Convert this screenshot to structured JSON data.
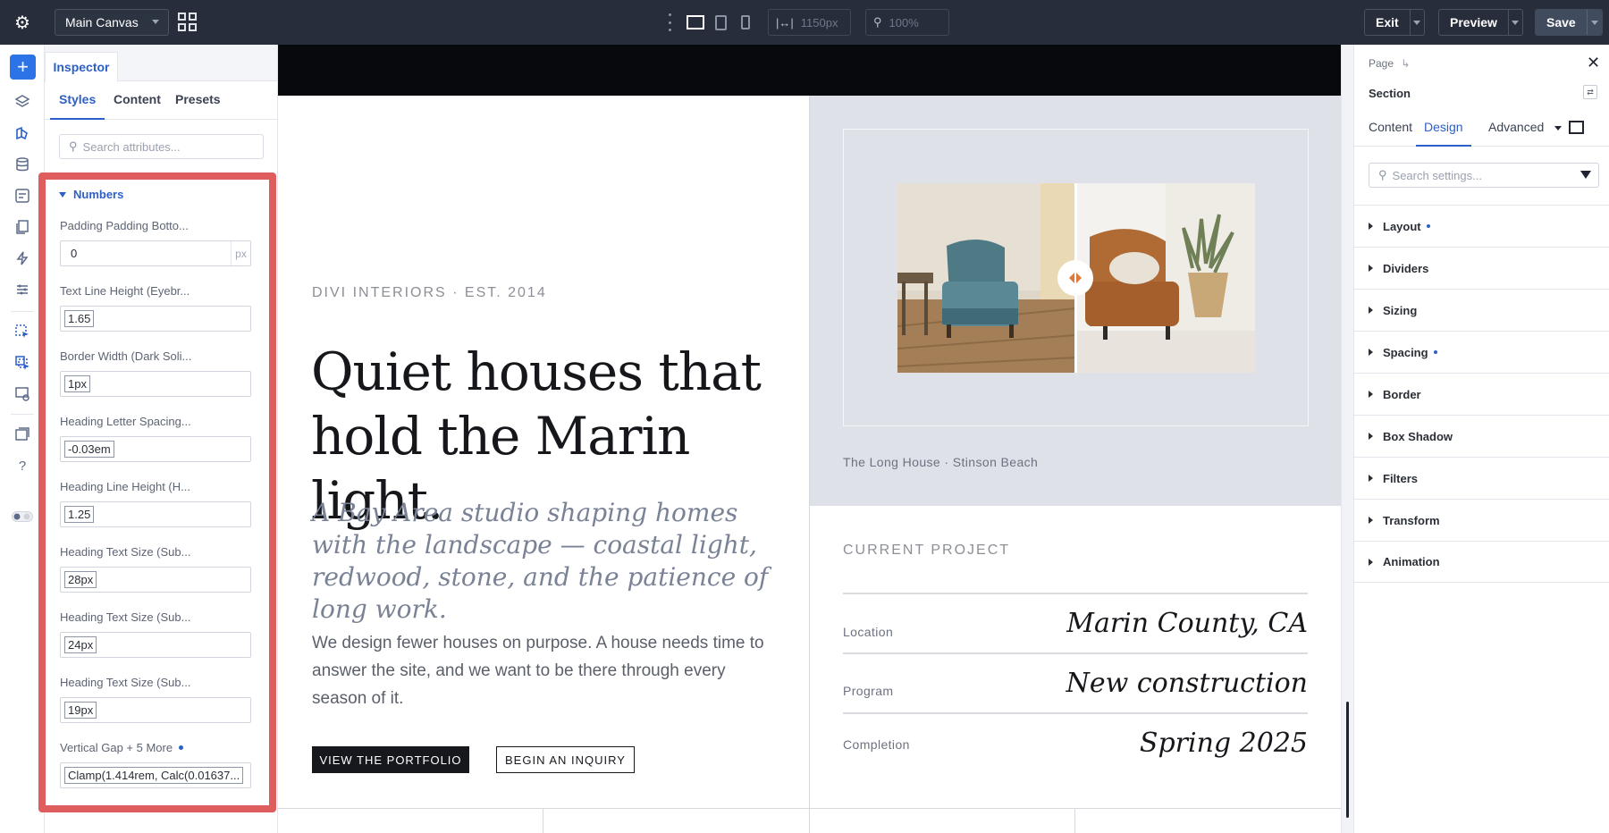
{
  "topbar": {
    "canvas_select": "Main Canvas",
    "width_value": "1150px",
    "zoom_value": "100%",
    "exit_label": "Exit",
    "preview_label": "Preview",
    "save_label": "Save"
  },
  "inspector": {
    "tab": "Inspector",
    "subtabs": [
      "Styles",
      "Content",
      "Presets"
    ],
    "search_placeholder": "Search attributes...",
    "group_label": "Numbers",
    "fields": [
      {
        "label": "Padding Padding Botto...",
        "value": "0",
        "unit": "px"
      },
      {
        "label": "Text Line Height (Eyebr...",
        "value": "1.65"
      },
      {
        "label": "Border Width (Dark Soli...",
        "value": "1px"
      },
      {
        "label": "Heading Letter Spacing...",
        "value": "-0.03em"
      },
      {
        "label": "Heading Line Height (H...",
        "value": "1.25"
      },
      {
        "label": "Heading Text Size (Sub...",
        "value": "28px"
      },
      {
        "label": "Heading Text Size (Sub...",
        "value": "24px"
      },
      {
        "label": "Heading Text Size (Sub...",
        "value": "19px"
      },
      {
        "label": "Vertical Gap + 5 More",
        "value": "Clamp(1.414rem, Calc(0.01637..."
      }
    ]
  },
  "canvas": {
    "eyebrow": "DIVI INTERIORS · EST. 2014",
    "heading": "Quiet houses that hold the Marin light.",
    "subheading": "A Bay Area studio shaping homes with the landscape — coastal light, redwood, stone, and the patience of long work.",
    "body": "We design fewer houses on purpose. A house needs time to answer the site, and we want to be there through every season of it.",
    "primary_button": "VIEW THE PORTFOLIO",
    "secondary_button": "BEGIN AN INQUIRY",
    "image_caption": "The Long House · Stinson Beach",
    "project_title": "CURRENT PROJECT",
    "project_rows": [
      {
        "label": "Location",
        "value": "Marin County, CA"
      },
      {
        "label": "Program",
        "value": "New construction"
      },
      {
        "label": "Completion",
        "value": "Spring 2025"
      }
    ]
  },
  "settings": {
    "breadcrumb": "Page",
    "section_title": "Section",
    "tabs": [
      "Content",
      "Design",
      "Advanced"
    ],
    "search_placeholder": "Search settings...",
    "groups": [
      "Layout",
      "Dividers",
      "Sizing",
      "Spacing",
      "Border",
      "Box Shadow",
      "Filters",
      "Transform",
      "Animation"
    ]
  },
  "colors": {
    "accent": "#2c5fc7",
    "topbar": "#272d3b",
    "highlight": "#e05d5d",
    "add_button": "#2b73e6"
  }
}
